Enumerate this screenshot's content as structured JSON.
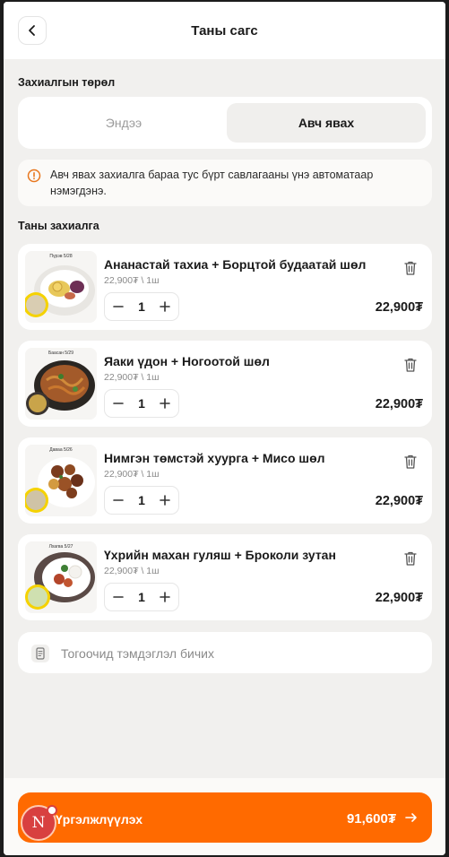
{
  "header": {
    "title": "Таны сагс"
  },
  "order_type": {
    "label": "Захиалгын төрөл",
    "options": [
      {
        "label": "Эндээ",
        "active": false
      },
      {
        "label": "Авч явах",
        "active": true
      }
    ]
  },
  "notice": {
    "text": "Авч явах захиалга бараа тус бүрт савлагааны үнэ автоматаар нэмэгдэнэ."
  },
  "order": {
    "label": "Таны захиалга",
    "items": [
      {
        "tag": "Пүрэв 5/28",
        "name": "Ананастай тахиа + Борцтой будаатай шөл",
        "unit": "22,900₮ \\ 1ш",
        "qty": "1",
        "price": "22,900₮"
      },
      {
        "tag": "Баасан 5/29",
        "name": "Яаки үдон + Ногоотой шөл",
        "unit": "22,900₮ \\ 1ш",
        "qty": "1",
        "price": "22,900₮"
      },
      {
        "tag": "Даваа 5/26",
        "name": "Нимгэн төмстэй хуурга + Мисо шөл",
        "unit": "22,900₮ \\ 1ш",
        "qty": "1",
        "price": "22,900₮"
      },
      {
        "tag": "Лхагва 5/27",
        "name": "Үхрийн махан гуляш + Броколи зутан",
        "unit": "22,900₮ \\ 1ш",
        "qty": "1",
        "price": "22,900₮"
      }
    ]
  },
  "note": {
    "placeholder": "Тогоочид тэмдэглэл бичих"
  },
  "checkout": {
    "label": "Үргэлжлүүлэх",
    "total": "91,600₮"
  },
  "avatar": {
    "initial": "N"
  },
  "colors": {
    "accent": "#ff6a00",
    "background": "#f1f0ee",
    "card": "#ffffff",
    "notice_icon": "#e8771e"
  },
  "icons": [
    "chevron-left-icon",
    "info-icon",
    "trash-icon",
    "minus-icon",
    "plus-icon",
    "note-icon",
    "arrow-right-icon"
  ]
}
